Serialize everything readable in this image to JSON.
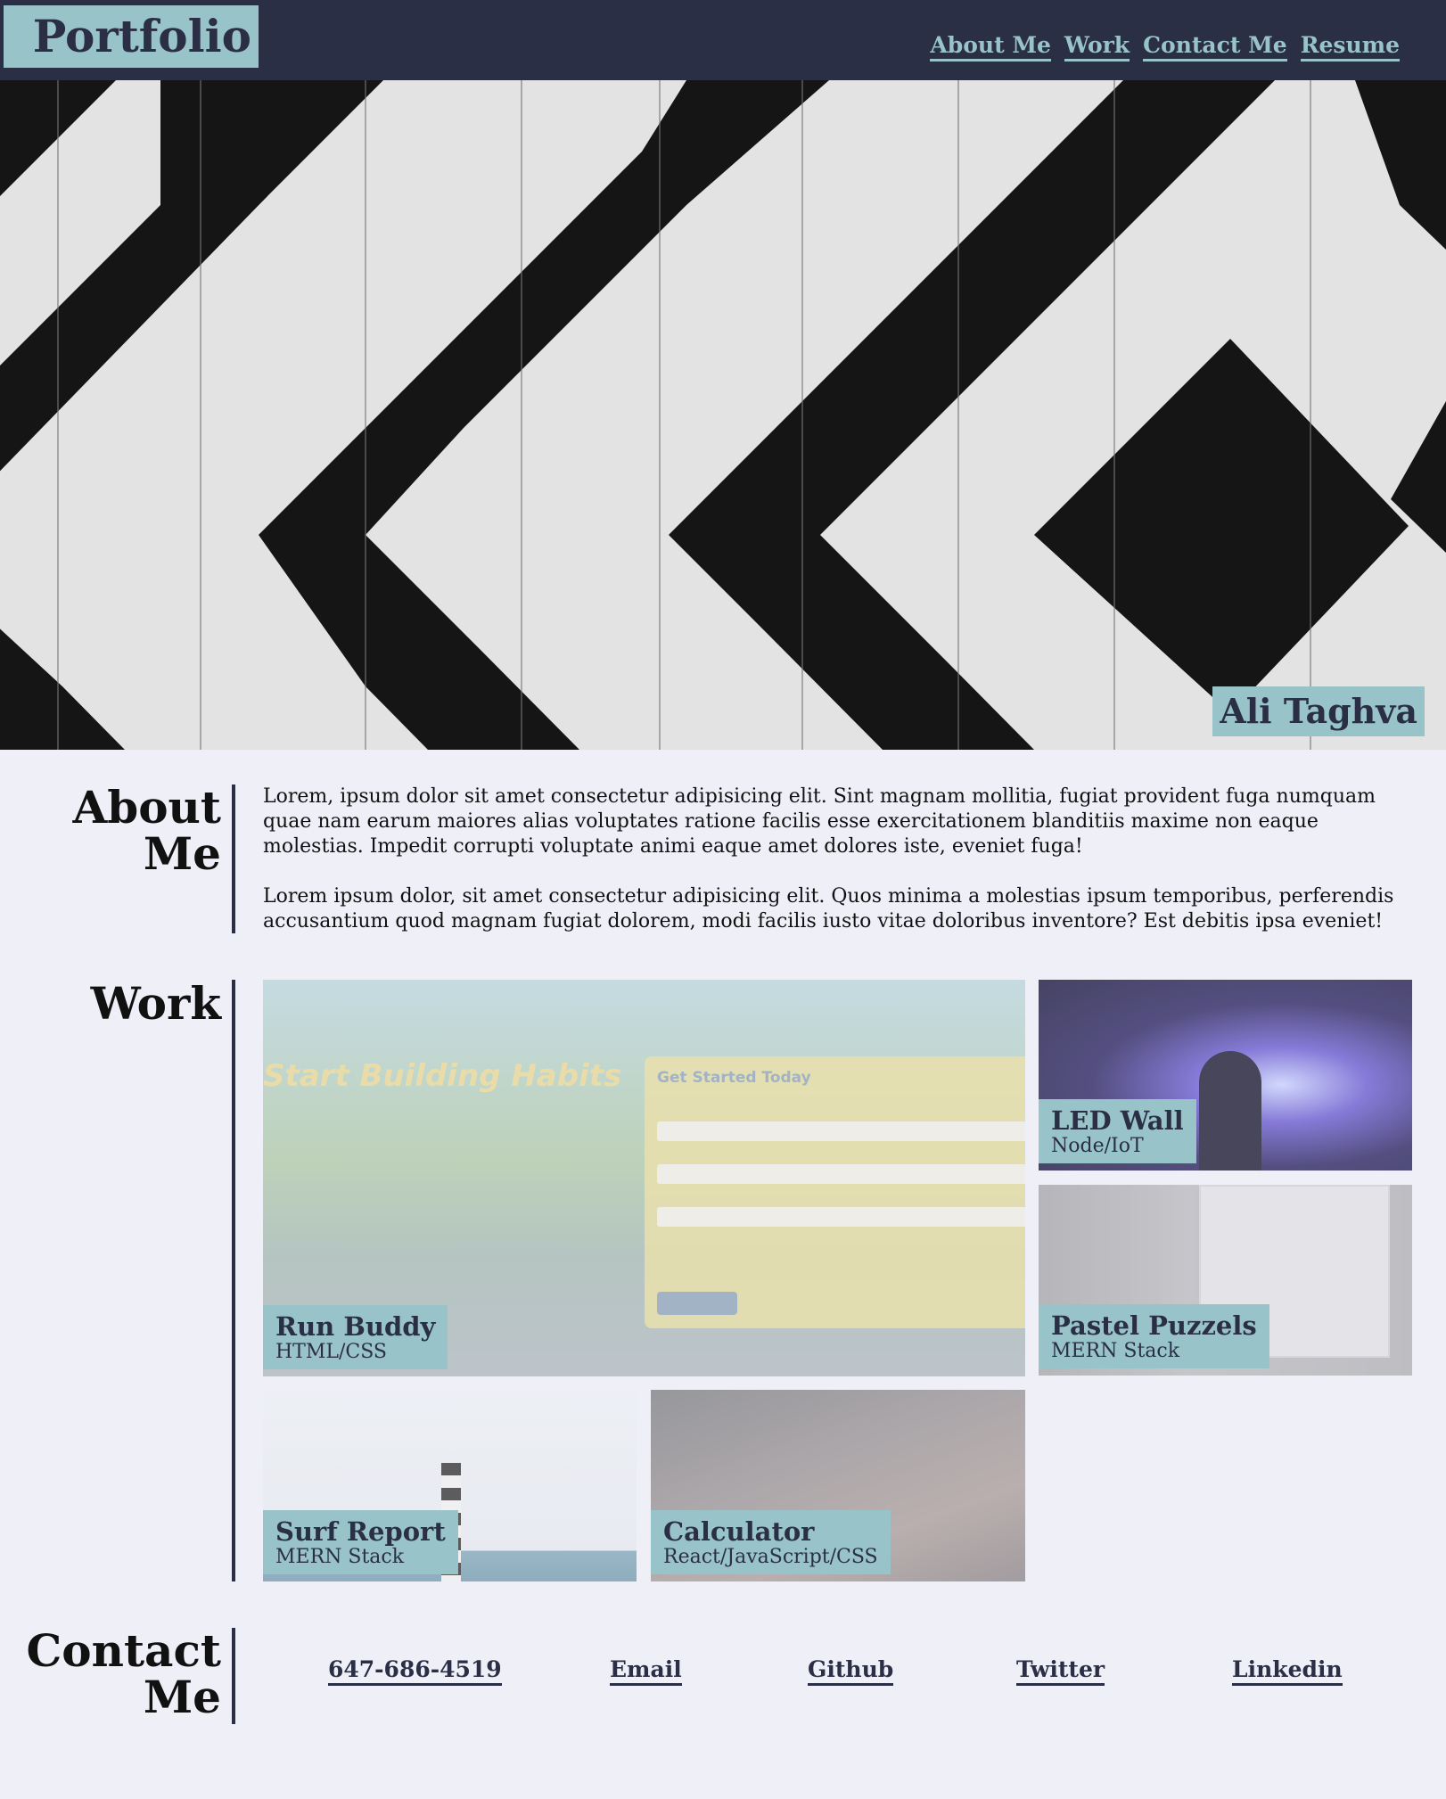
{
  "header": {
    "logo": "Portfolio",
    "nav": [
      "About Me",
      "Work",
      "Contact Me",
      "Resume"
    ]
  },
  "hero": {
    "name": "Ali Taghva"
  },
  "about": {
    "title_line1": "About",
    "title_line2": "Me",
    "paragraphs": [
      "Lorem, ipsum dolor sit amet consectetur adipisicing elit. Sint magnam mollitia, fugiat provident fuga numquam quae nam earum maiores alias voluptates ratione facilis esse exercitationem blanditiis maxime non eaque molestias. Impedit corrupti voluptate animi eaque amet dolores iste, eveniet fuga!",
      "Lorem ipsum dolor, sit amet consectetur adipisicing elit. Quos minima a molestias ipsum temporibus, perferendis accusantium quod magnam fugiat dolorem, modi facilis iusto vitae doloribus inventore? Est debitis ipsa eveniet!"
    ]
  },
  "work": {
    "title": "Work",
    "projects": [
      {
        "name": "Run Buddy",
        "stack": "HTML/CSS",
        "preview_heading": "Start Building Habits",
        "preview_form_title": "Get Started Today"
      },
      {
        "name": "LED Wall",
        "stack": "Node/IoT"
      },
      {
        "name": "Pastel Puzzels",
        "stack": "MERN Stack"
      },
      {
        "name": "Surf Report",
        "stack": "MERN Stack"
      },
      {
        "name": "Calculator",
        "stack": "React/JavaScript/CSS"
      }
    ]
  },
  "contact": {
    "title_line1": "Contact",
    "title_line2": "Me",
    "links": [
      "647-686-4519",
      "Email",
      "Github",
      "Twitter",
      "Linkedin"
    ]
  },
  "colors": {
    "header_bg": "#2b2f46",
    "accent": "#98c3c9",
    "page_bg": "#efeff8"
  }
}
